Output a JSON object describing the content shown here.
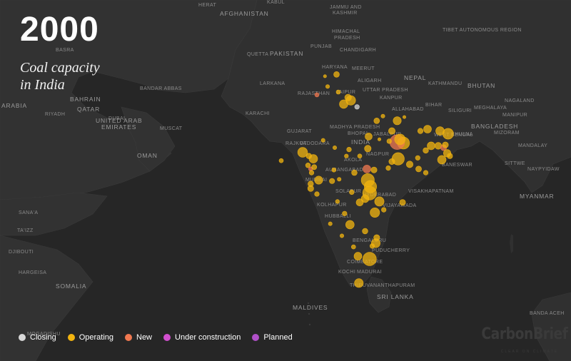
{
  "year": "2000",
  "subtitle_line1": "Coal capacity",
  "subtitle_line2": "in India",
  "brand": {
    "name": "CarbonBrief",
    "tagline": "CLEAR ON CLIMATE"
  },
  "legend": [
    {
      "label": "Closing",
      "color": "#d8d8d8"
    },
    {
      "label": "Operating",
      "color": "#f2b40f"
    },
    {
      "label": "New",
      "color": "#f07850"
    },
    {
      "label": "Under construction",
      "color": "#d24fcf"
    },
    {
      "label": "Planned",
      "color": "#b050c8"
    }
  ],
  "place_labels": [
    {
      "text": "AFGHANISTAN",
      "kind": "country"
    },
    {
      "text": "PAKISTAN",
      "kind": "country"
    },
    {
      "text": "INDIA",
      "kind": "country"
    },
    {
      "text": "NEPAL",
      "kind": "country"
    },
    {
      "text": "BHUTAN",
      "kind": "country"
    },
    {
      "text": "BANGLADESH",
      "kind": "country"
    },
    {
      "text": "MYANMAR",
      "kind": "country"
    },
    {
      "text": "OMAN",
      "kind": "country"
    },
    {
      "text": "QATAR",
      "kind": "country"
    },
    {
      "text": "BAHRAIN",
      "kind": "country"
    },
    {
      "text": "UNITED ARAB",
      "kind": "country"
    },
    {
      "text": "EMIRATES",
      "kind": "country"
    },
    {
      "text": "SOMALIA",
      "kind": "country"
    },
    {
      "text": "SRI LANKA",
      "kind": "country"
    },
    {
      "text": "MALDIVES",
      "kind": "country"
    },
    {
      "text": "ARABIA",
      "kind": "country"
    },
    {
      "text": "KABUL",
      "kind": "city"
    },
    {
      "text": "JAMMU AND",
      "kind": "city"
    },
    {
      "text": "KASHMIR",
      "kind": "city"
    },
    {
      "text": "HERAT",
      "kind": "city"
    },
    {
      "text": "HIMACHAL",
      "kind": "city"
    },
    {
      "text": "PRADESH",
      "kind": "city"
    },
    {
      "text": "PUNJAB",
      "kind": "city"
    },
    {
      "text": "CHANDIGARH",
      "kind": "city"
    },
    {
      "text": "HARYANA",
      "kind": "city"
    },
    {
      "text": "MEERUT",
      "kind": "city"
    },
    {
      "text": "ALIGARH",
      "kind": "city"
    },
    {
      "text": "UTTAR PRADESH",
      "kind": "city"
    },
    {
      "text": "JAIPUR",
      "kind": "city"
    },
    {
      "text": "RAJASTHAN",
      "kind": "city"
    },
    {
      "text": "KANPUR",
      "kind": "city"
    },
    {
      "text": "ALLAHABAD",
      "kind": "city"
    },
    {
      "text": "KATHMANDU",
      "kind": "city"
    },
    {
      "text": "TIBET AUTONOMOUS REGION",
      "kind": "city"
    },
    {
      "text": "BIHAR",
      "kind": "city"
    },
    {
      "text": "SILIGURI",
      "kind": "city"
    },
    {
      "text": "MEGHALAYA",
      "kind": "city"
    },
    {
      "text": "NAGALAND",
      "kind": "city"
    },
    {
      "text": "MANIPUR",
      "kind": "city"
    },
    {
      "text": "MIZORAM",
      "kind": "city"
    },
    {
      "text": "KHULNA",
      "kind": "city"
    },
    {
      "text": "WEST BENGAL",
      "kind": "city"
    },
    {
      "text": "MANDALAY",
      "kind": "city"
    },
    {
      "text": "SITTWE",
      "kind": "city"
    },
    {
      "text": "NAYPYIDAW",
      "kind": "city"
    },
    {
      "text": "KARACHI",
      "kind": "city"
    },
    {
      "text": "LARKANA",
      "kind": "city"
    },
    {
      "text": "QUETTA",
      "kind": "city"
    },
    {
      "text": "BANDAR ABBAS",
      "kind": "city"
    },
    {
      "text": "DUBAI",
      "kind": "city"
    },
    {
      "text": "MUSCAT",
      "kind": "city"
    },
    {
      "text": "RIYADH",
      "kind": "city"
    },
    {
      "text": "BASRA",
      "kind": "city"
    },
    {
      "text": "GUJARAT",
      "kind": "city"
    },
    {
      "text": "RAJKOT",
      "kind": "city"
    },
    {
      "text": "VADODARA",
      "kind": "city"
    },
    {
      "text": "MADHYA PRADESH",
      "kind": "city"
    },
    {
      "text": "BHOPAL",
      "kind": "city"
    },
    {
      "text": "NAGPUR",
      "kind": "city"
    },
    {
      "text": "JABALPUR",
      "kind": "city"
    },
    {
      "text": "AKOLA",
      "kind": "city"
    },
    {
      "text": "AURANGABAD",
      "kind": "city"
    },
    {
      "text": "MUMBAI",
      "kind": "city"
    },
    {
      "text": "SOLAPUR",
      "kind": "city"
    },
    {
      "text": "HYDERABAD",
      "kind": "city"
    },
    {
      "text": "VISAKHAPATNAM",
      "kind": "city"
    },
    {
      "text": "VIJAYAWADA",
      "kind": "city"
    },
    {
      "text": "KOLHAPUR",
      "kind": "city"
    },
    {
      "text": "HUBBALLI",
      "kind": "city"
    },
    {
      "text": "BENGALURU",
      "kind": "city"
    },
    {
      "text": "PUDUCHERRY",
      "kind": "city"
    },
    {
      "text": "COIMBATORE",
      "kind": "city"
    },
    {
      "text": "KOCHI",
      "kind": "city"
    },
    {
      "text": "MADURAI",
      "kind": "city"
    },
    {
      "text": "THIRUVANANTHAPURAM",
      "kind": "city"
    },
    {
      "text": "BANESWAR",
      "kind": "city"
    },
    {
      "text": "SANA'A",
      "kind": "city"
    },
    {
      "text": "TA'IZZ",
      "kind": "city"
    },
    {
      "text": "DJIBOUTI",
      "kind": "city"
    },
    {
      "text": "HARGEISA",
      "kind": "city"
    },
    {
      "text": "MOGADISHU",
      "kind": "city"
    },
    {
      "text": "BANDA ACEH",
      "kind": "city"
    }
  ],
  "plants": [
    {
      "status": "Operating",
      "lon": 74.5,
      "lat": 31.2,
      "mw": 120
    },
    {
      "status": "Operating",
      "lon": 75.8,
      "lat": 31.4,
      "mw": 440
    },
    {
      "status": "Operating",
      "lon": 74.8,
      "lat": 30.1,
      "mw": 200
    },
    {
      "status": "New",
      "lon": 73.6,
      "lat": 29.2,
      "mw": 250
    },
    {
      "status": "Operating",
      "lon": 76.0,
      "lat": 29.5,
      "mw": 250
    },
    {
      "status": "Operating",
      "lon": 77.1,
      "lat": 28.9,
      "mw": 600
    },
    {
      "status": "Operating",
      "lon": 77.4,
      "lat": 28.6,
      "mw": 1260
    },
    {
      "status": "Operating",
      "lon": 76.6,
      "lat": 28.2,
      "mw": 1000
    },
    {
      "status": "Closing",
      "lon": 78.1,
      "lat": 27.9,
      "mw": 300
    },
    {
      "status": "Operating",
      "lon": 80.3,
      "lat": 26.4,
      "mw": 440
    },
    {
      "status": "Operating",
      "lon": 81.0,
      "lat": 26.9,
      "mw": 200
    },
    {
      "status": "Operating",
      "lon": 82.6,
      "lat": 26.4,
      "mw": 900
    },
    {
      "status": "Operating",
      "lon": 83.4,
      "lat": 26.8,
      "mw": 100
    },
    {
      "status": "Operating",
      "lon": 82.0,
      "lat": 25.3,
      "mw": 600
    },
    {
      "status": "Operating",
      "lon": 79.4,
      "lat": 24.7,
      "mw": 700
    },
    {
      "status": "Operating",
      "lon": 80.6,
      "lat": 24.4,
      "mw": 100
    },
    {
      "status": "Operating",
      "lon": 83.3,
      "lat": 24.0,
      "mw": 2000
    },
    {
      "status": "New",
      "lon": 82.6,
      "lat": 24.1,
      "mw": 3000
    },
    {
      "status": "Operating",
      "lon": 82.9,
      "lat": 24.4,
      "mw": 1550
    },
    {
      "status": "Operating",
      "lon": 81.7,
      "lat": 24.2,
      "mw": 300
    },
    {
      "status": "Operating",
      "lon": 85.2,
      "lat": 25.3,
      "mw": 400
    },
    {
      "status": "Operating",
      "lon": 86.0,
      "lat": 25.5,
      "mw": 840
    },
    {
      "status": "Operating",
      "lon": 87.4,
      "lat": 25.3,
      "mw": 1000
    },
    {
      "status": "Operating",
      "lon": 88.3,
      "lat": 25.0,
      "mw": 1600
    },
    {
      "status": "Operating",
      "lon": 86.4,
      "lat": 23.7,
      "mw": 840
    },
    {
      "status": "Operating",
      "lon": 87.2,
      "lat": 23.7,
      "mw": 630
    },
    {
      "status": "New",
      "lon": 87.8,
      "lat": 23.5,
      "mw": 500
    },
    {
      "status": "Operating",
      "lon": 88.0,
      "lat": 23.8,
      "mw": 500
    },
    {
      "status": "Operating",
      "lon": 88.2,
      "lat": 22.9,
      "mw": 750
    },
    {
      "status": "Operating",
      "lon": 88.5,
      "lat": 22.6,
      "mw": 400
    },
    {
      "status": "Operating",
      "lon": 87.6,
      "lat": 22.2,
      "mw": 1000
    },
    {
      "status": "Operating",
      "lon": 85.8,
      "lat": 23.2,
      "mw": 420
    },
    {
      "status": "Operating",
      "lon": 84.9,
      "lat": 22.4,
      "mw": 300
    },
    {
      "status": "Operating",
      "lon": 85.0,
      "lat": 21.2,
      "mw": 460
    },
    {
      "status": "Operating",
      "lon": 84.0,
      "lat": 21.7,
      "mw": 600
    },
    {
      "status": "Operating",
      "lon": 85.8,
      "lat": 20.8,
      "mw": 300
    },
    {
      "status": "Operating",
      "lon": 82.7,
      "lat": 22.3,
      "mw": 2100
    },
    {
      "status": "Operating",
      "lon": 82.0,
      "lat": 22.0,
      "mw": 500
    },
    {
      "status": "Operating",
      "lon": 81.6,
      "lat": 21.3,
      "mw": 300
    },
    {
      "status": "New",
      "lon": 79.2,
      "lat": 21.2,
      "mw": 840
    },
    {
      "status": "Operating",
      "lon": 80.0,
      "lat": 21.1,
      "mw": 500
    },
    {
      "status": "Operating",
      "lon": 79.3,
      "lat": 20.0,
      "mw": 2340
    },
    {
      "status": "Operating",
      "lon": 79.6,
      "lat": 19.3,
      "mw": 2100
    },
    {
      "status": "Operating",
      "lon": 77.8,
      "lat": 20.8,
      "mw": 420
    },
    {
      "status": "Operating",
      "lon": 76.1,
      "lat": 20.1,
      "mw": 200
    },
    {
      "status": "Operating",
      "lon": 75.5,
      "lat": 21.1,
      "mw": 250
    },
    {
      "status": "Operating",
      "lon": 76.9,
      "lat": 22.6,
      "mw": 210
    },
    {
      "status": "Operating",
      "lon": 77.2,
      "lat": 23.3,
      "mw": 300
    },
    {
      "status": "Operating",
      "lon": 78.4,
      "lat": 22.6,
      "mw": 250
    },
    {
      "status": "Operating",
      "lon": 79.3,
      "lat": 23.4,
      "mw": 600
    },
    {
      "status": "Operating",
      "lon": 75.6,
      "lat": 23.5,
      "mw": 200
    },
    {
      "status": "Operating",
      "lon": 74.3,
      "lat": 24.3,
      "mw": 200
    },
    {
      "status": "Operating",
      "lon": 69.6,
      "lat": 22.1,
      "mw": 250
    },
    {
      "status": "Operating",
      "lon": 72.0,
      "lat": 23.0,
      "mw": 1300
    },
    {
      "status": "Operating",
      "lon": 72.7,
      "lat": 22.6,
      "mw": 420
    },
    {
      "status": "Operating",
      "lon": 73.2,
      "lat": 22.3,
      "mw": 1000
    },
    {
      "status": "Operating",
      "lon": 72.6,
      "lat": 21.6,
      "mw": 320
    },
    {
      "status": "New",
      "lon": 72.9,
      "lat": 21.2,
      "mw": 250
    },
    {
      "status": "Operating",
      "lon": 73.0,
      "lat": 20.8,
      "mw": 300
    },
    {
      "status": "Operating",
      "lon": 73.3,
      "lat": 21.4,
      "mw": 350
    },
    {
      "status": "Operating",
      "lon": 72.9,
      "lat": 19.6,
      "mw": 420
    },
    {
      "status": "Operating",
      "lon": 72.9,
      "lat": 19.1,
      "mw": 500
    },
    {
      "status": "Operating",
      "lon": 73.8,
      "lat": 20.0,
      "mw": 910
    },
    {
      "status": "Operating",
      "lon": 75.3,
      "lat": 19.9,
      "mw": 380
    },
    {
      "status": "Operating",
      "lon": 73.6,
      "lat": 18.5,
      "mw": 300
    },
    {
      "status": "Operating",
      "lon": 75.9,
      "lat": 17.7,
      "mw": 210
    },
    {
      "status": "Operating",
      "lon": 77.5,
      "lat": 18.7,
      "mw": 300
    },
    {
      "status": "Operating",
      "lon": 79.5,
      "lat": 18.6,
      "mw": 2600
    },
    {
      "status": "Operating",
      "lon": 79.0,
      "lat": 18.0,
      "mw": 800
    },
    {
      "status": "Operating",
      "lon": 78.4,
      "lat": 17.6,
      "mw": 700
    },
    {
      "status": "Operating",
      "lon": 80.6,
      "lat": 17.7,
      "mw": 1200
    },
    {
      "status": "Operating",
      "lon": 80.1,
      "lat": 16.5,
      "mw": 1260
    },
    {
      "status": "Operating",
      "lon": 81.1,
      "lat": 16.8,
      "mw": 300
    },
    {
      "status": "Operating",
      "lon": 83.2,
      "lat": 17.6,
      "mw": 500
    },
    {
      "status": "Operating",
      "lon": 76.7,
      "lat": 16.4,
      "mw": 300
    },
    {
      "status": "Operating",
      "lon": 75.1,
      "lat": 15.3,
      "mw": 200
    },
    {
      "status": "Operating",
      "lon": 77.3,
      "lat": 15.2,
      "mw": 1000
    },
    {
      "status": "Operating",
      "lon": 79.0,
      "lat": 14.5,
      "mw": 420
    },
    {
      "status": "Operating",
      "lon": 76.4,
      "lat": 14.0,
      "mw": 200
    },
    {
      "status": "Operating",
      "lon": 80.2,
      "lat": 13.2,
      "mw": 1050
    },
    {
      "status": "Operating",
      "lon": 80.3,
      "lat": 13.8,
      "mw": 500
    },
    {
      "status": "Operating",
      "lon": 77.7,
      "lat": 12.8,
      "mw": 250
    },
    {
      "status": "Operating",
      "lon": 79.5,
      "lat": 11.5,
      "mw": 2490
    },
    {
      "status": "Operating",
      "lon": 78.2,
      "lat": 11.8,
      "mw": 840
    },
    {
      "status": "Operating",
      "lon": 79.8,
      "lat": 12.9,
      "mw": 300
    },
    {
      "status": "Operating",
      "lon": 78.3,
      "lat": 8.9,
      "mw": 1050
    }
  ]
}
